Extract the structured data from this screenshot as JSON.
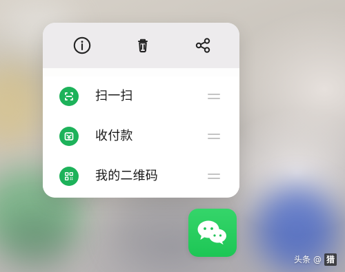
{
  "context_menu": {
    "top_actions": [
      {
        "icon": "info-icon"
      },
      {
        "icon": "trash-icon"
      },
      {
        "icon": "share-icon"
      }
    ],
    "items": [
      {
        "label": "扫一扫",
        "icon": "scan-icon",
        "handle": "drag-handle"
      },
      {
        "label": "收付款",
        "icon": "payment-icon",
        "handle": "drag-handle"
      },
      {
        "label": "我的二维码",
        "icon": "qr-code-icon",
        "handle": "drag-handle"
      }
    ]
  },
  "app_icon": {
    "name": "wechat-app-icon",
    "accent": "#1fc357"
  },
  "watermark": {
    "prefix": "头条",
    "suffix": "@",
    "box_text": "猎"
  },
  "colors": {
    "menu_green": "#1db25a",
    "menu_text": "#191919",
    "top_bar": "#edebed"
  }
}
